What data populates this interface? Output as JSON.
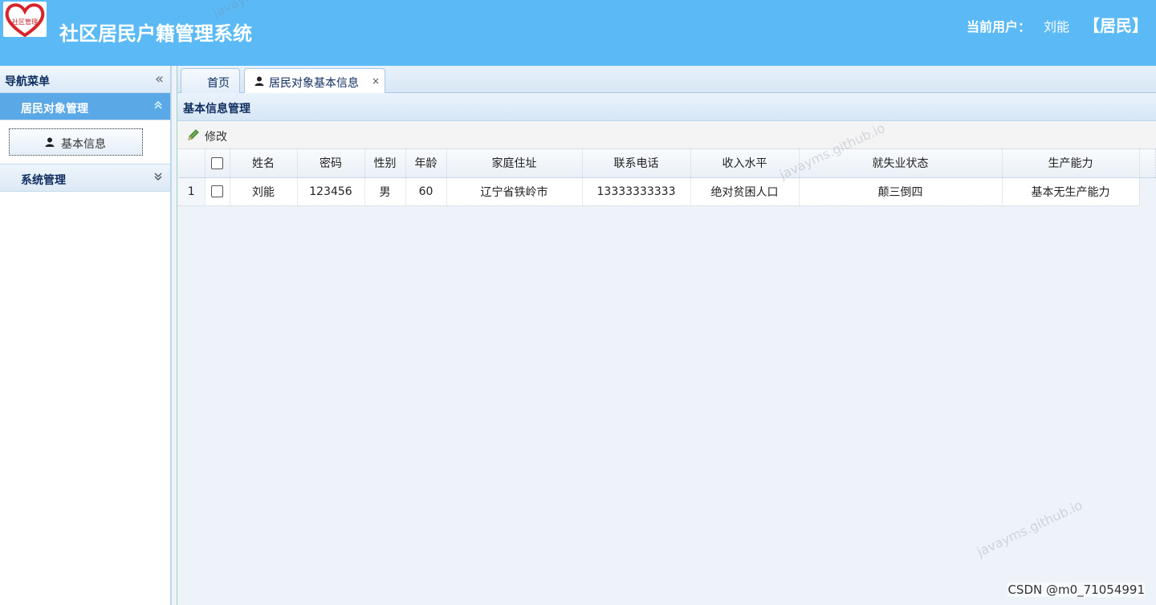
{
  "header": {
    "logo_text": "社区管理",
    "app_title": "社区居民户籍管理系统",
    "user_label": "当前用户：",
    "user_name": "刘能",
    "user_role": "【居民】",
    "background_color": "#5bbaf6"
  },
  "nav": {
    "title": "导航菜单",
    "collapse_icon": "double-chevron-left-icon",
    "groups": [
      {
        "title": "居民对象管理",
        "toggle_icon": "double-chevron-up-icon",
        "expanded": true,
        "items": [
          {
            "label": "基本信息",
            "icon": "user-icon"
          }
        ]
      },
      {
        "title": "系统管理",
        "toggle_icon": "double-chevron-down-icon",
        "expanded": false
      }
    ]
  },
  "tabs": [
    {
      "label": "首页"
    },
    {
      "label": "居民对象基本信息",
      "icon": "user-icon",
      "close": "×",
      "active": true
    }
  ],
  "panel": {
    "title": "基本信息管理",
    "toolbar": {
      "edit_label": "修改",
      "edit_icon": "pencil-icon"
    }
  },
  "grid": {
    "columns": [
      "姓名",
      "密码",
      "性别",
      "年龄",
      "家庭住址",
      "联系电话",
      "收入水平",
      "就失业状态",
      "生产能力"
    ],
    "rows": [
      {
        "rownum": "1",
        "cells": [
          "刘能",
          "123456",
          "男",
          "60",
          "辽宁省铁岭市",
          "13333333333",
          "绝对贫困人口",
          "颠三倒四",
          "基本无生产能力"
        ]
      }
    ]
  },
  "watermarks": {
    "site": "javayms.github.io",
    "csdn": "CSDN @m0_71054991"
  }
}
